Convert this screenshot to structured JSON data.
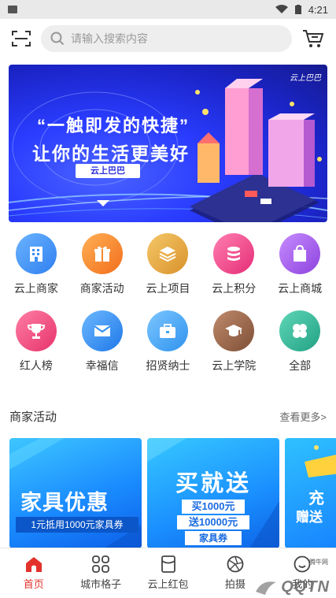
{
  "status_bar": {
    "time": "4:21"
  },
  "search": {
    "placeholder": "请输入搜索内容"
  },
  "banner": {
    "line1": "“一触即发的快捷”",
    "line2": "让你的生活更美好",
    "tag": "云上巴巴",
    "logo": "云上巴巴"
  },
  "grid": [
    {
      "label": "云上商家",
      "icon": "building-icon",
      "color": "#3d8df5"
    },
    {
      "label": "商家活动",
      "icon": "gift-icon",
      "color": "#f58a2c"
    },
    {
      "label": "云上项目",
      "icon": "layers-icon",
      "color": "#e9a93a"
    },
    {
      "label": "云上积分",
      "icon": "coins-icon",
      "color": "#f0458a"
    },
    {
      "label": "云上商城",
      "icon": "shopping-bag-icon",
      "color": "#a75ee8"
    },
    {
      "label": "红人榜",
      "icon": "trophy-icon",
      "color": "#ef4a7e"
    },
    {
      "label": "幸福信",
      "icon": "envelope-icon",
      "color": "#2d8ff0"
    },
    {
      "label": "招贤纳士",
      "icon": "briefcase-icon",
      "color": "#3da6f3"
    },
    {
      "label": "云上学院",
      "icon": "graduation-cap-icon",
      "color": "#9c6a4f"
    },
    {
      "label": "全部",
      "icon": "clover-icon",
      "color": "#35b99a"
    }
  ],
  "section": {
    "title": "商家活动",
    "more": "查看更多>"
  },
  "cards": {
    "card1": {
      "title": "家具优惠",
      "sub": "1元抵用1000元家具券"
    },
    "card2": {
      "title": "买就送",
      "l1": "买1000元",
      "l2": "送10000元",
      "l3": "家具券"
    },
    "card3": {
      "t1": "充",
      "t2": "赠送"
    }
  },
  "bottom_nav": [
    {
      "label": "首页",
      "icon": "home-icon",
      "active": true
    },
    {
      "label": "城市格子",
      "icon": "grid-icon",
      "active": false
    },
    {
      "label": "云上红包",
      "icon": "red-packet-icon",
      "active": false
    },
    {
      "label": "拍摄",
      "icon": "camera-shutter-icon",
      "active": false
    },
    {
      "label": "我的",
      "icon": "user-icon",
      "active": false
    }
  ],
  "watermark": {
    "text": "QQTN",
    "small": "腾牛网"
  },
  "colors": {
    "accent": "#e2322b",
    "banner_blue": "#2a3cff"
  }
}
